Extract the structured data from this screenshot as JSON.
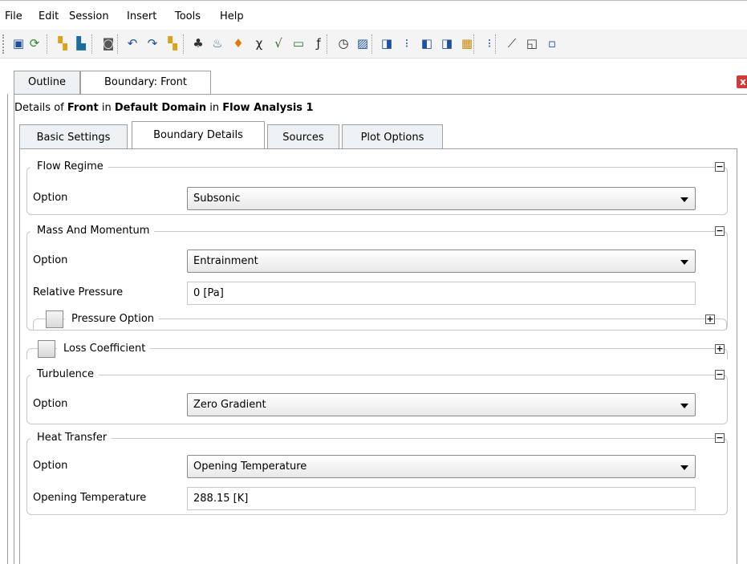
{
  "menu": [
    "File",
    "Edit",
    "Session",
    "Insert",
    "Tools",
    "Help"
  ],
  "toolbar_icons": [
    {
      "name": "save-icon",
      "glyph": "▣",
      "color": "#1e4fa3"
    },
    {
      "name": "refresh-icon",
      "glyph": "⟳",
      "color": "#2d8a2d"
    },
    {
      "name": "import-mesh-icon",
      "glyph": "▚",
      "color": "#d9a21a"
    },
    {
      "name": "mesh-icon",
      "glyph": "▙",
      "color": "#1a6e9c"
    },
    {
      "name": "camera-icon",
      "glyph": "◙",
      "color": "#555555"
    },
    {
      "name": "undo-icon",
      "glyph": "↶",
      "color": "#1e4fa3"
    },
    {
      "name": "redo-icon",
      "glyph": "↷",
      "color": "#1e4fa3"
    },
    {
      "name": "load-icon",
      "glyph": "▚",
      "color": "#d9a21a"
    },
    {
      "name": "domain-icon",
      "glyph": "♣",
      "color": "#333333"
    },
    {
      "name": "material-icon",
      "glyph": "♨",
      "color": "#3a6a9c"
    },
    {
      "name": "reaction-icon",
      "glyph": "♦",
      "color": "#e07810"
    },
    {
      "name": "expression-icon",
      "glyph": "χ",
      "color": "#222222"
    },
    {
      "name": "function-icon",
      "glyph": "√",
      "color": "#2d6a2d"
    },
    {
      "name": "user-routine-icon",
      "glyph": "▭",
      "color": "#2d6a2d"
    },
    {
      "name": "fx-icon",
      "glyph": "ƒ",
      "color": "#222222"
    },
    {
      "name": "timer-icon",
      "glyph": "◷",
      "color": "#222222"
    },
    {
      "name": "output-icon",
      "glyph": "▨",
      "color": "#1e4fa3"
    },
    {
      "name": "domain-box-icon",
      "glyph": "◨",
      "color": "#1e4fa3"
    },
    {
      "name": "boundary-icon",
      "glyph": "⁝",
      "color": "#1e4fa3"
    },
    {
      "name": "interface-icon",
      "glyph": "◧",
      "color": "#1e4fa3"
    },
    {
      "name": "subdomain-icon",
      "glyph": "◨",
      "color": "#1e4fa3"
    },
    {
      "name": "mesh-adapt-icon",
      "glyph": "▦",
      "color": "#c98a10"
    },
    {
      "name": "initialization-icon",
      "glyph": "⁝",
      "color": "#1e4fa3"
    },
    {
      "name": "monitor-icon",
      "glyph": "⟋",
      "color": "#333333"
    },
    {
      "name": "solver-icon",
      "glyph": "◱",
      "color": "#333333"
    },
    {
      "name": "solver-control-icon",
      "glyph": "▫",
      "color": "#1e4fa3"
    }
  ],
  "tabs": {
    "outer": [
      "Outline",
      "Boundary: Front"
    ],
    "inner": [
      "Basic Settings",
      "Boundary Details",
      "Sources",
      "Plot Options"
    ]
  },
  "details": {
    "prefix": "Details of",
    "object": "Front",
    "in1": "in",
    "domain": "Default Domain",
    "in2": "in",
    "analysis": "Flow Analysis 1"
  },
  "groups": {
    "flow_regime": {
      "title": "Flow Regime",
      "option_label": "Option",
      "option_value": "Subsonic"
    },
    "mass_momentum": {
      "title": "Mass And Momentum",
      "option_label": "Option",
      "option_value": "Entrainment",
      "pressure_label": "Relative Pressure",
      "pressure_value": "0 [Pa]",
      "pressure_option": "Pressure Option"
    },
    "loss_coefficient": {
      "title": "Loss Coefficient"
    },
    "turbulence": {
      "title": "Turbulence",
      "option_label": "Option",
      "option_value": "Zero Gradient"
    },
    "heat_transfer": {
      "title": "Heat Transfer",
      "option_label": "Option",
      "option_value": "Opening Temperature",
      "temp_label": "Opening Temperature",
      "temp_value": "288.15 [K]"
    }
  },
  "toggle_glyphs": {
    "collapse": "−",
    "expand": "+"
  },
  "close_glyph": "x"
}
